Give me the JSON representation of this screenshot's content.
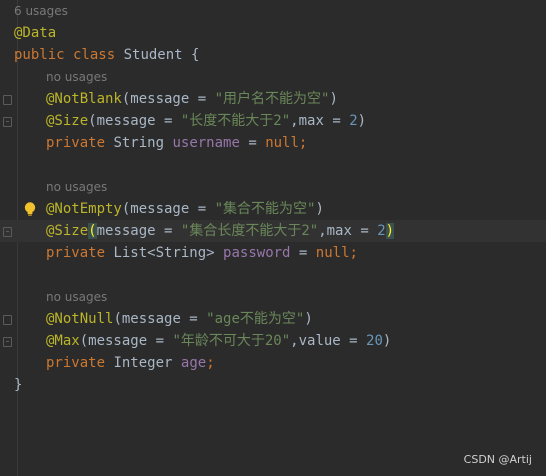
{
  "editor": {
    "usages_header": "6 usages",
    "class_annotation": "@Data",
    "class_decl": {
      "kw": "public class",
      "name": "Student",
      "brace": "{"
    },
    "fields": [
      {
        "hint": "no usages",
        "ann1": {
          "name": "@NotBlank",
          "pre": "(message = ",
          "str": "\"用户名不能为空\"",
          "post": ")"
        },
        "ann2": {
          "name": "@Size",
          "pre": "(message = ",
          "str": "\"长度不能大于2\"",
          "mid": ",max = ",
          "num": "2",
          "post": ")"
        },
        "decl": {
          "kw": "private",
          "type": "String",
          "name": "username",
          "eq": " = ",
          "val": "null",
          "semi": ";"
        }
      },
      {
        "hint": "no usages",
        "ann1": {
          "name": "@NotEmpty",
          "pre": "(message = ",
          "str": "\"集合不能为空\"",
          "post": ")"
        },
        "ann2": {
          "name": "@Size",
          "open": "(",
          "pre": "message = ",
          "str": "\"集合长度不能大于2\"",
          "mid": ",max = ",
          "num": "2",
          "post": ")"
        },
        "decl": {
          "kw": "private",
          "type": "List<String>",
          "name": "password",
          "eq": " = ",
          "val": "null",
          "semi": ";"
        }
      },
      {
        "hint": "no usages",
        "ann1": {
          "name": "@NotNull",
          "pre": "(message = ",
          "str": "\"age不能为空\"",
          "post": ")"
        },
        "ann2": {
          "name": "@Max",
          "pre": "(message = ",
          "str": "\"年龄不可大于20\"",
          "mid": ",value = ",
          "num": "20",
          "post": ")"
        },
        "decl": {
          "kw": "private",
          "type": "Integer",
          "name": "age",
          "semi": ";"
        }
      }
    ],
    "closing_brace": "}"
  },
  "watermark": "CSDN @Artij",
  "icons": {
    "intention": "lightbulb-icon",
    "fold": "fold-marker-icon"
  },
  "colors": {
    "background": "#2b2b2b",
    "annotation": "#bbb529",
    "keyword": "#cc7832",
    "string": "#6a8759",
    "number": "#6897bb",
    "field": "#9876aa",
    "hint": "#787878"
  }
}
